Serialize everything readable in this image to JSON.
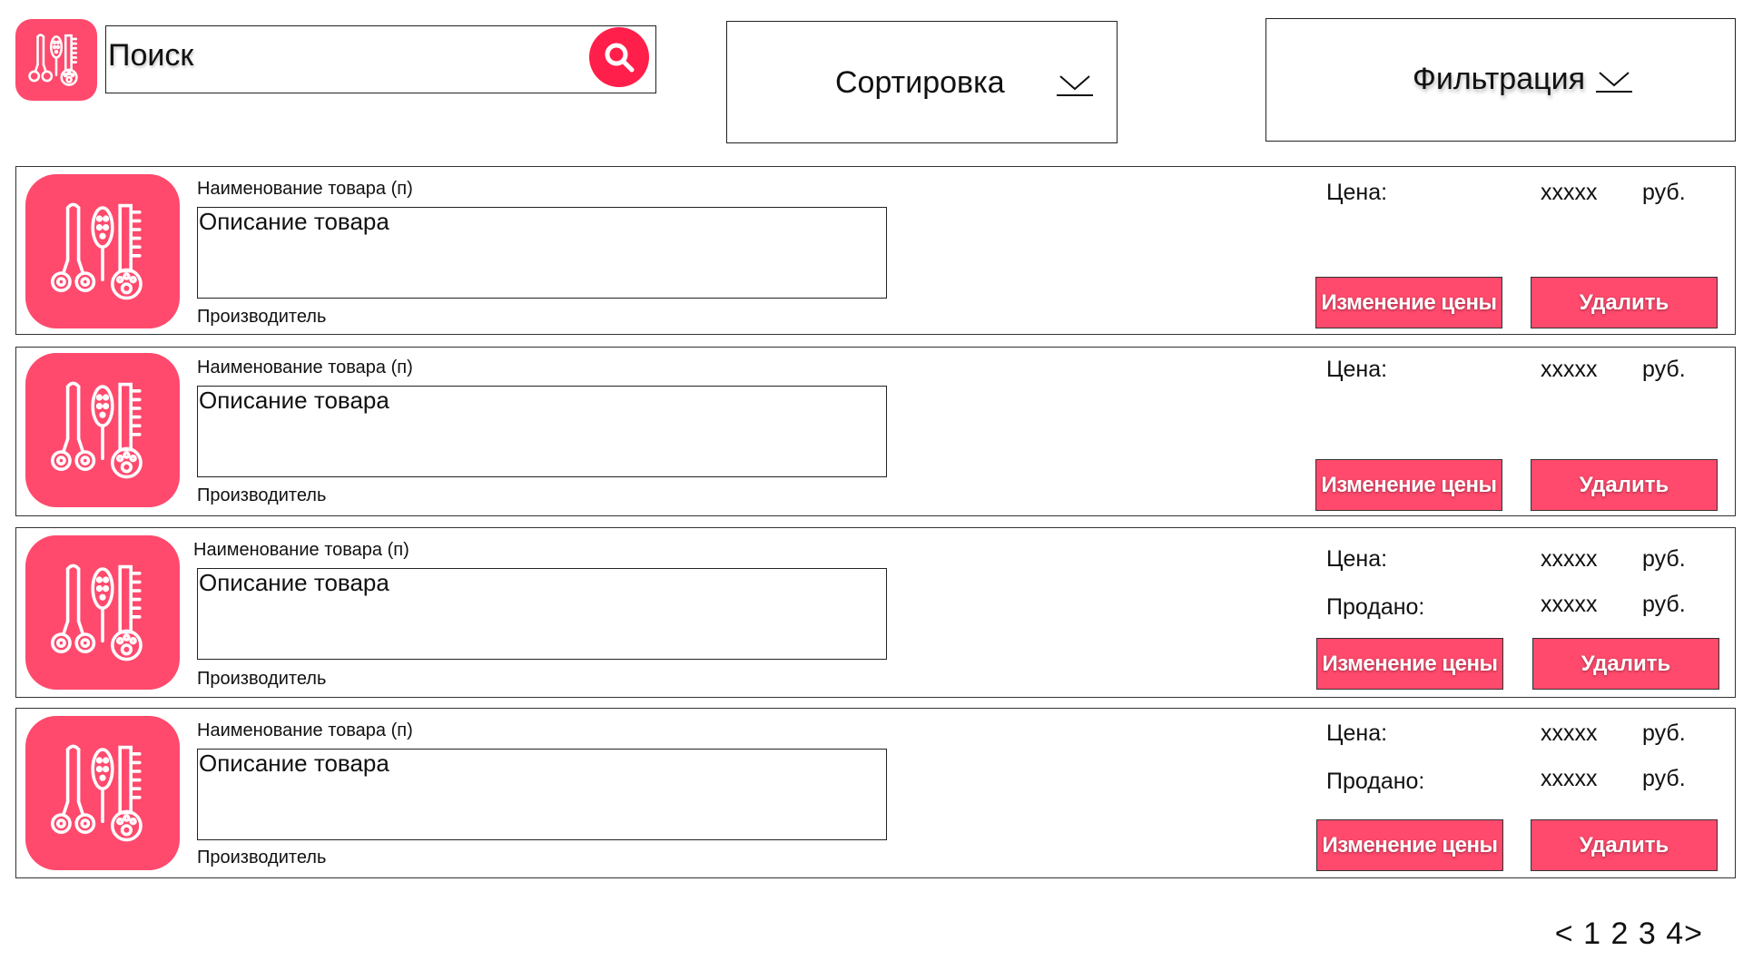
{
  "header": {
    "search": {
      "label": "Поиск"
    },
    "sort": {
      "label": "Сортировка"
    },
    "filter": {
      "label": "Фильтрация"
    }
  },
  "products": [
    {
      "name": "Наименование товара (п)",
      "description": "Описание товара",
      "maker": "Производитель",
      "price_label": "Цена:",
      "price_value": "xxxxx",
      "price_unit": "руб.",
      "change_price_label": "Изменение цены",
      "delete_label": "Удалить"
    },
    {
      "name": "Наименование товара (п)",
      "description": "Описание товара",
      "maker": "Производитель",
      "price_label": "Цена:",
      "price_value": "xxxxx",
      "price_unit": "руб.",
      "change_price_label": "Изменение цены",
      "delete_label": "Удалить"
    },
    {
      "name": "Наименование товара (п)",
      "description": "Описание товара",
      "maker": "Производитель",
      "price_label": "Цена:",
      "price_value": "xxxxx",
      "price_unit": "руб.",
      "sold_label": "Продано:",
      "sold_value": "xxxxx",
      "sold_unit": "руб.",
      "change_price_label": "Изменение цены",
      "delete_label": "Удалить"
    },
    {
      "name": "Наименование товара (п)",
      "description": "Описание товара",
      "maker": "Производитель",
      "price_label": "Цена:",
      "price_value": "xxxxx",
      "price_unit": "руб.",
      "sold_label": "Продано:",
      "sold_value": "xxxxx",
      "sold_unit": "руб.",
      "change_price_label": "Изменение цены",
      "delete_label": "Удалить"
    }
  ],
  "pagination": {
    "prev": "<",
    "pages": [
      "1",
      "2",
      "3",
      "4"
    ],
    "next": ">"
  },
  "colors": {
    "accent": "#ff4a6d",
    "search_button": "#ff1f4a",
    "border": "#222222"
  },
  "icons": [
    "grooming-tools-icon",
    "search-icon",
    "chevron-down-icon"
  ]
}
